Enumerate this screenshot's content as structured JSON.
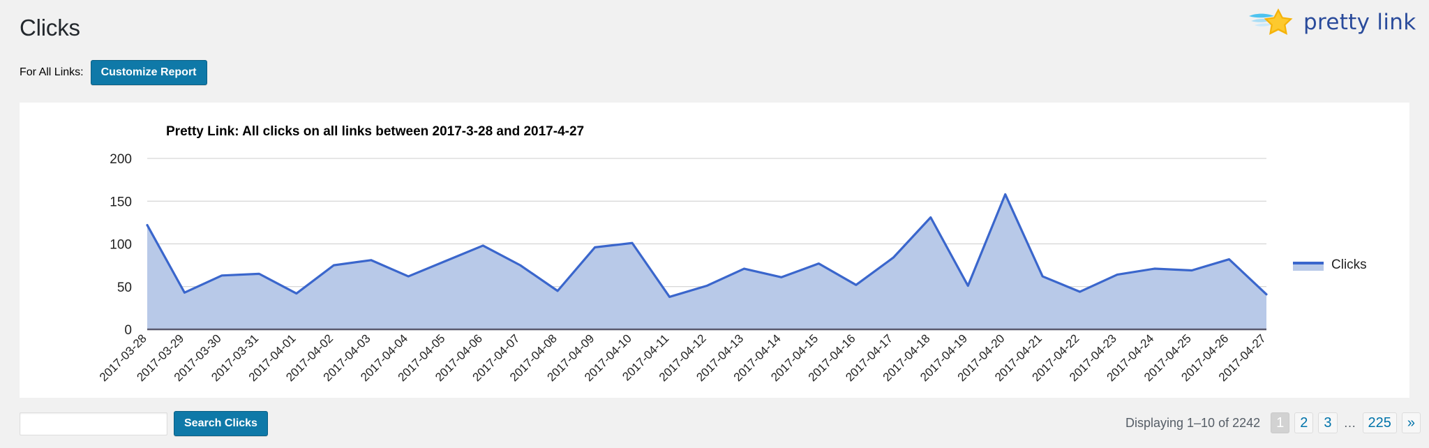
{
  "header": {
    "page_title": "Clicks",
    "for_all_links_label": "For All Links:",
    "customize_report_label": "Customize Report"
  },
  "logo": {
    "text": "pretty link",
    "mark_name": "pretty-link-star-icon",
    "star_color": "#f5b30a",
    "swoosh_color": "#4ec3ef",
    "text_color": "#2a4b9b"
  },
  "chart_card": {
    "title": "Pretty Link: All clicks on all links between 2017-3-28 and 2017-4-27",
    "legend_label": "Clicks"
  },
  "footer": {
    "search_value": "",
    "search_placeholder": "",
    "search_button_label": "Search Clicks",
    "displaying_text": "Displaying 1–10 of 2242",
    "pages": [
      {
        "label": "1",
        "current": true
      },
      {
        "label": "2",
        "current": false
      },
      {
        "label": "3",
        "current": false
      }
    ],
    "ellipsis": "…",
    "last_page": "225",
    "next_label": "»"
  },
  "colors": {
    "accent_blue": "#0f79a8",
    "link_blue": "#0073aa",
    "series_line": "#3a66cc",
    "series_fill": "#b8c9e8",
    "page_bg": "#f1f1f1",
    "card_bg": "#ffffff"
  },
  "chart_data": {
    "type": "area",
    "title": "Pretty Link: All clicks on all links between 2017-3-28 and 2017-4-27",
    "xlabel": "",
    "ylabel": "",
    "ylim": [
      0,
      200
    ],
    "yticks": [
      0,
      50,
      100,
      150,
      200
    ],
    "grid": true,
    "legend_position": "right",
    "series_name": "Clicks",
    "categories": [
      "2017-03-28",
      "2017-03-29",
      "2017-03-30",
      "2017-03-31",
      "2017-04-01",
      "2017-04-02",
      "2017-04-03",
      "2017-04-04",
      "2017-04-05",
      "2017-04-06",
      "2017-04-07",
      "2017-04-08",
      "2017-04-09",
      "2017-04-10",
      "2017-04-11",
      "2017-04-12",
      "2017-04-13",
      "2017-04-14",
      "2017-04-15",
      "2017-04-16",
      "2017-04-17",
      "2017-04-18",
      "2017-04-19",
      "2017-04-20",
      "2017-04-21",
      "2017-04-22",
      "2017-04-23",
      "2017-04-24",
      "2017-04-25",
      "2017-04-26",
      "2017-04-27"
    ],
    "values": [
      122,
      43,
      63,
      65,
      42,
      75,
      81,
      62,
      80,
      98,
      75,
      45,
      96,
      101,
      38,
      51,
      71,
      61,
      77,
      52,
      84,
      131,
      51,
      158,
      62,
      44,
      64,
      71,
      69,
      82,
      41
    ]
  }
}
